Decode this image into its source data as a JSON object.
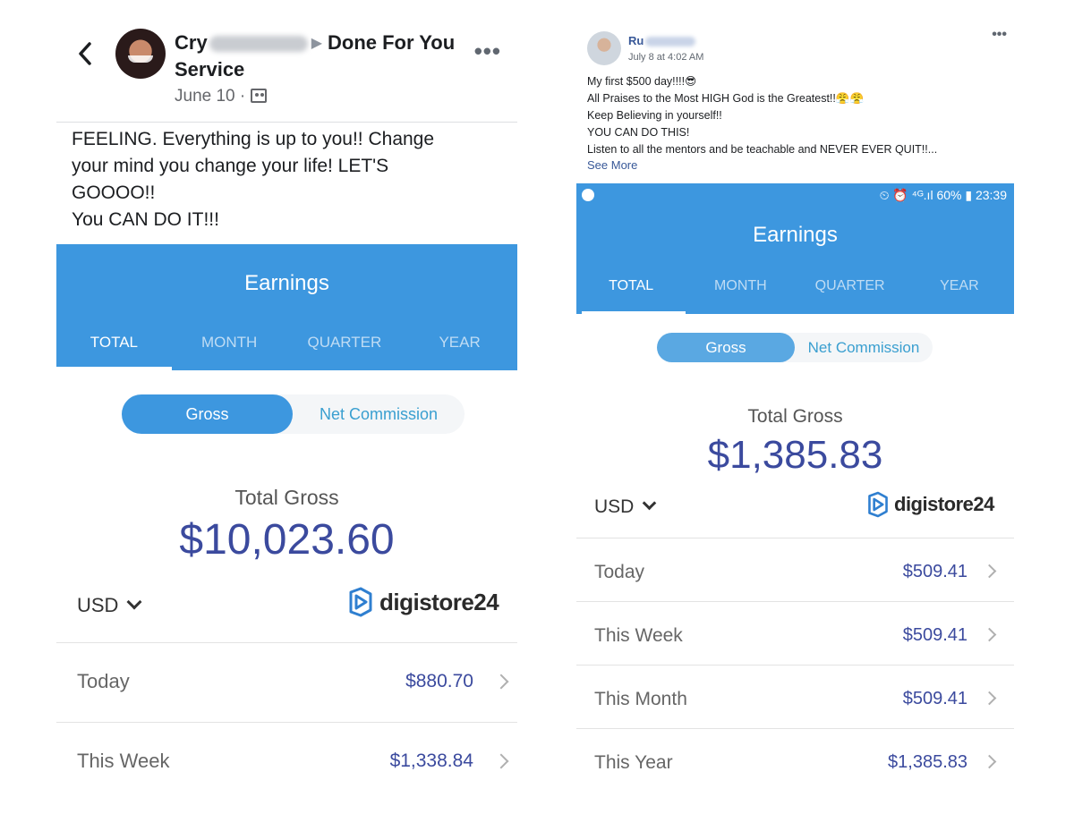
{
  "left": {
    "post": {
      "author_visible_start": "Cry",
      "page_name": "Done For You Service",
      "date": "June 10 ·",
      "text": "FEELING.   Everything is up to you!! Change\nyour mind you change your life! LET'S\nGOOOO!!\nYou CAN DO IT!!!"
    },
    "app": {
      "title": "Earnings",
      "tabs": [
        "TOTAL",
        "MONTH",
        "QUARTER",
        "YEAR"
      ],
      "active_tab": "TOTAL",
      "segment": {
        "gross": "Gross",
        "net": "Net Commission"
      },
      "total_label": "Total Gross",
      "total_value": "$10,023.60",
      "currency": "USD",
      "brand": "digistore24",
      "rows": [
        {
          "label": "Today",
          "value": "$880.70"
        },
        {
          "label": "This Week",
          "value": "$1,338.84"
        }
      ]
    }
  },
  "right": {
    "post": {
      "author_visible_start": "Ru",
      "date": "July 8 at 4:02 AM",
      "text": "My first $500 day!!!!😎\nAll Praises to the Most HIGH God is the Greatest!!😤😤\nKeep Believing in yourself!!\nYOU CAN DO THIS!\nListen to all the mentors and be teachable and NEVER EVER QUIT!!...",
      "see_more": "See More"
    },
    "status_bar": {
      "right": "⏲ ⏰ ⁴ᴳ.ıl 60% ▮ 23:39"
    },
    "app": {
      "title": "Earnings",
      "tabs": [
        "TOTAL",
        "MONTH",
        "QUARTER",
        "YEAR"
      ],
      "active_tab": "TOTAL",
      "segment": {
        "gross": "Gross",
        "net": "Net Commission"
      },
      "total_label": "Total Gross",
      "total_value": "$1,385.83",
      "currency": "USD",
      "brand": "digistore24",
      "rows": [
        {
          "label": "Today",
          "value": "$509.41"
        },
        {
          "label": "This Week",
          "value": "$509.41"
        },
        {
          "label": "This Month",
          "value": "$509.41"
        },
        {
          "label": "This Year",
          "value": "$1,385.83"
        }
      ]
    }
  },
  "colors": {
    "app_blue": "#3d97df",
    "amount_blue": "#3b4a9e",
    "link_blue": "#385898"
  }
}
